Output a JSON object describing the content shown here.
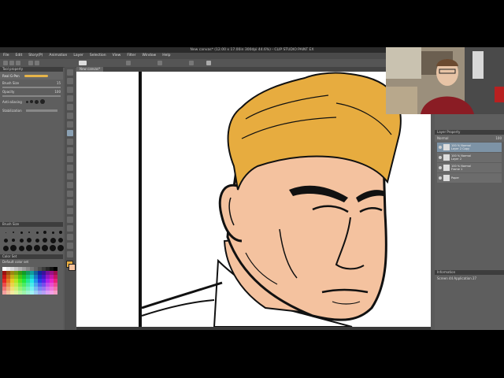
{
  "window": {
    "title": "New canvas* (12.00 x 17.00in 300dpi 44.6%) - CLIP STUDIO PAINT EX"
  },
  "menu": [
    "File",
    "Edit",
    "Story(P)",
    "Animation",
    "Layer",
    "Selection",
    "View",
    "Filter",
    "Window",
    "Help"
  ],
  "canvas_tab": {
    "label": "New canvas*"
  },
  "left_panel": {
    "tool_property_title": "Tool property",
    "brush_name": "Real G-Pen",
    "brush_size_label": "Brush Size",
    "brush_size_value": "15",
    "opacity_label": "Opacity",
    "opacity_value": "100",
    "antialiasing_label": "Anti-aliasing",
    "stabilization_label": "Stabilization",
    "brush_size_panel_title": "Brush Size",
    "color_set_title": "Color Set",
    "color_set_name": "Default color set"
  },
  "right_panel": {
    "layer_property_title": "Layer Property",
    "blend_mode": "Normal",
    "opacity_value": "100",
    "layers": [
      {
        "name": "100 % Normal",
        "sub": "Layer 2 Copy"
      },
      {
        "name": "100 % Normal",
        "sub": "Layer 2"
      },
      {
        "name": "100 % Normal",
        "sub": "Frame 1"
      },
      {
        "name": "Paper",
        "sub": ""
      }
    ],
    "info_title": "Information",
    "info_line": "Screen 44 Application 27"
  },
  "colors": {
    "hair": "#E7AC3F",
    "skin": "#F4C29F",
    "ink": "#111111",
    "paper": "#FFFFFF",
    "ui_bg": "#5A5A5A",
    "selected_layer": "#7D93A6"
  }
}
